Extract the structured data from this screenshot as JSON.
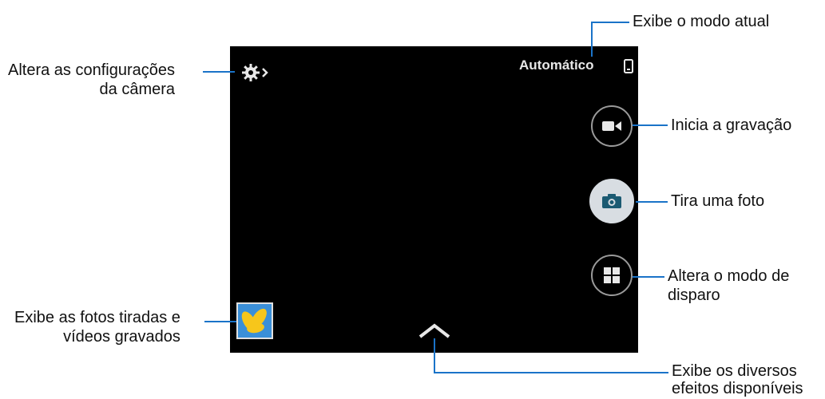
{
  "screen": {
    "mode_label": "Automático"
  },
  "icons": {
    "settings": "gear-icon",
    "storage": "phone-storage-icon",
    "record": "video-camera-icon",
    "photo": "camera-icon",
    "mode": "grid-icon",
    "effects": "chevron-up-icon",
    "gallery": "gallery-thumbnail"
  },
  "callouts": {
    "settings_line1": "Altera as configurações",
    "settings_line2": "da câmera",
    "mode_current": "Exibe o modo atual",
    "record": "Inicia a gravação",
    "photo": "Tira uma foto",
    "mode_line1": "Altera o modo de",
    "mode_line2": "disparo",
    "gallery_line1": "Exibe as fotos tiradas e",
    "gallery_line2": "vídeos gravados",
    "effects_line1": "Exibe os diversos",
    "effects_line2": "efeitos disponíveis"
  },
  "colors": {
    "leader_line": "#1a73c8",
    "screen_bg": "#000000"
  }
}
